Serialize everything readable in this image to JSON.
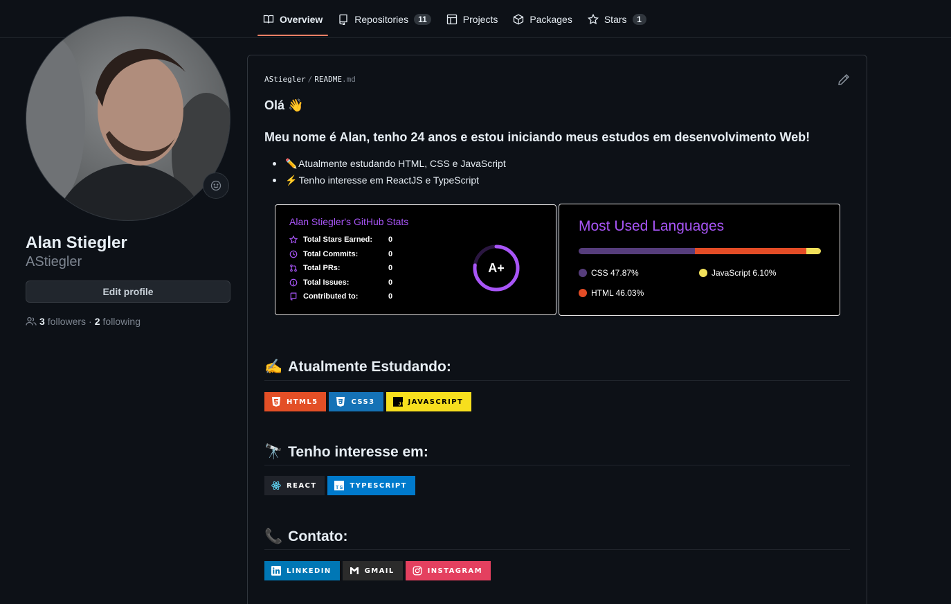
{
  "nav": {
    "tabs": [
      {
        "label": "Overview"
      },
      {
        "label": "Repositories",
        "count": "11"
      },
      {
        "label": "Projects"
      },
      {
        "label": "Packages"
      },
      {
        "label": "Stars",
        "count": "1"
      }
    ]
  },
  "profile": {
    "fullname": "Alan Stiegler",
    "username": "AStiegler",
    "edit_label": "Edit profile",
    "followers_count": "3",
    "followers_label": "followers",
    "dot": "·",
    "following_count": "2",
    "following_label": "following"
  },
  "readme": {
    "owner": "AStiegler",
    "sep": "/",
    "file": "README",
    "ext": ".md",
    "greeting": "Olá 👋",
    "intro": "Meu nome é Alan, tenho 24 anos e estou iniciando meus estudos em desenvolvimento Web!",
    "bullets": [
      {
        "emoji": "✏️",
        "text": "Atualmente estudando HTML, CSS e JavaScript"
      },
      {
        "emoji": "⚡",
        "text": "Tenho interesse em ReactJS e TypeScript"
      }
    ]
  },
  "stats_card": {
    "title": "Alan Stiegler's GitHub Stats",
    "rows": [
      {
        "label": "Total Stars Earned:",
        "value": "0"
      },
      {
        "label": "Total Commits:",
        "value": "0"
      },
      {
        "label": "Total PRs:",
        "value": "0"
      },
      {
        "label": "Total Issues:",
        "value": "0"
      },
      {
        "label": "Contributed to:",
        "value": "0"
      }
    ],
    "grade": "A+",
    "accent": "#a855f7"
  },
  "langs_card": {
    "title": "Most Used Languages",
    "languages": [
      {
        "name": "CSS",
        "percent": 47.87,
        "label": "CSS 47.87%",
        "color": "#563d7c"
      },
      {
        "name": "HTML",
        "percent": 46.03,
        "label": "HTML 46.03%",
        "color": "#e34c26"
      },
      {
        "name": "JavaScript",
        "percent": 6.1,
        "label": "JavaScript 6.10%",
        "color": "#f1e05a"
      }
    ]
  },
  "sections": {
    "studying": {
      "emoji": "✍️",
      "title": "Atualmente Estudando:",
      "badges": [
        {
          "label": "HTML5",
          "color": "#e34f26"
        },
        {
          "label": "CSS3",
          "color": "#1572b6"
        },
        {
          "label": "JAVASCRIPT",
          "color": "#f7df1e"
        }
      ]
    },
    "interests": {
      "emoji": "🔭",
      "title": "Tenho interesse em:",
      "badges": [
        {
          "label": "REACT",
          "color": "#20232a"
        },
        {
          "label": "TYPESCRIPT",
          "color": "#007acc"
        }
      ]
    },
    "contact": {
      "emoji": "📞",
      "title": "Contato:",
      "badges": [
        {
          "label": "LINKEDIN",
          "color": "#0077b5"
        },
        {
          "label": "GMAIL",
          "color": "#2b2b2b"
        },
        {
          "label": "INSTAGRAM",
          "color": "#e4405f"
        }
      ]
    }
  }
}
